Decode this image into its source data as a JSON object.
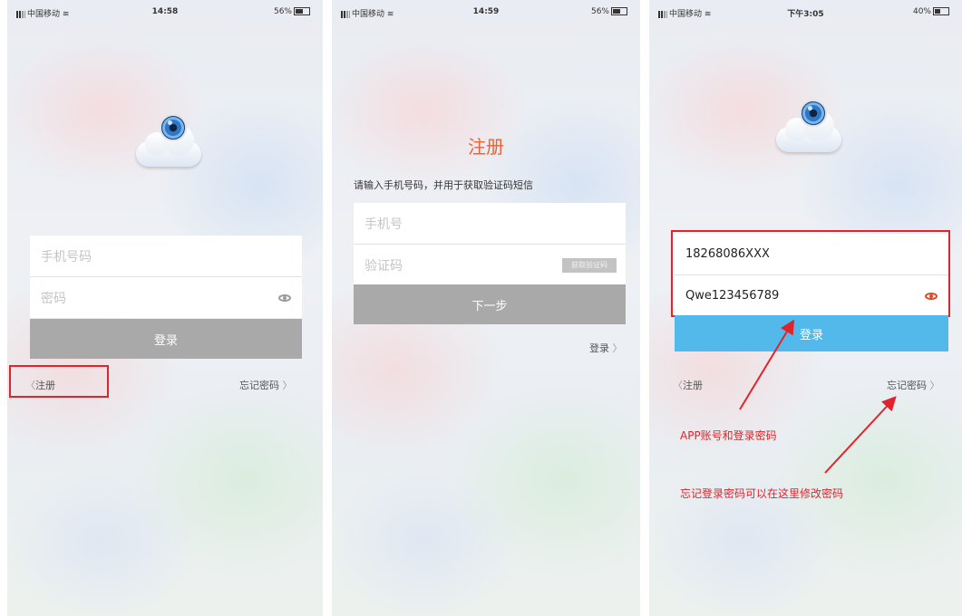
{
  "screens": [
    {
      "status": {
        "carrier": "中国移动",
        "time": "14:58",
        "battery": "56%"
      },
      "phone_placeholder": "手机号码",
      "password_placeholder": "密码",
      "login_label": "登录",
      "register_label": "注册",
      "forgot_label": "忘记密码"
    },
    {
      "status": {
        "carrier": "中国移动",
        "time": "14:59",
        "battery": "56%"
      },
      "title": "注册",
      "instruction": "请输入手机号码，并用于获取验证码短信",
      "phone_placeholder": "手机号",
      "code_placeholder": "验证码",
      "get_code_label": "获取验证码",
      "next_label": "下一步",
      "login_link": "登录"
    },
    {
      "status": {
        "carrier": "中国移动",
        "time": "下午3:05",
        "battery": "40%"
      },
      "phone_value": "18268086XXX",
      "password_value": "Qwe123456789",
      "login_label": "登录",
      "register_label": "注册",
      "forgot_label": "忘记密码",
      "annotation_account": "APP账号和登录密码",
      "annotation_forgot": "忘记登录密码可以在这里修改密码"
    }
  ],
  "colors": {
    "annotation_red": "#e0242b",
    "login_blue": "#52b9ea",
    "button_gray": "#a9a9a9",
    "title_orange": "#e6643a"
  },
  "icons": [
    "camera-cloud-logo",
    "eye-icon",
    "chevron-left-icon",
    "chevron-right-icon",
    "signal-icon",
    "wifi-icon",
    "battery-icon"
  ]
}
